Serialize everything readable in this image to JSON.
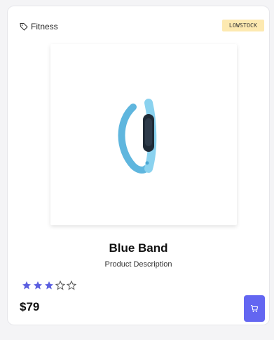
{
  "product": {
    "category": "Fitness",
    "stock_badge": "LOWSTOCK",
    "name": "Blue Band",
    "description": "Product Description",
    "rating": 3,
    "rating_max": 5,
    "price": "$79"
  },
  "icons": {
    "category": "tag-icon",
    "cart": "cart-icon",
    "star_filled": "star-filled-icon",
    "star_empty": "star-outline-icon"
  },
  "colors": {
    "accent": "#6366f1",
    "star": "#5b5fe0",
    "badge_bg": "#fde9b0",
    "band": "#7cc7e8"
  }
}
